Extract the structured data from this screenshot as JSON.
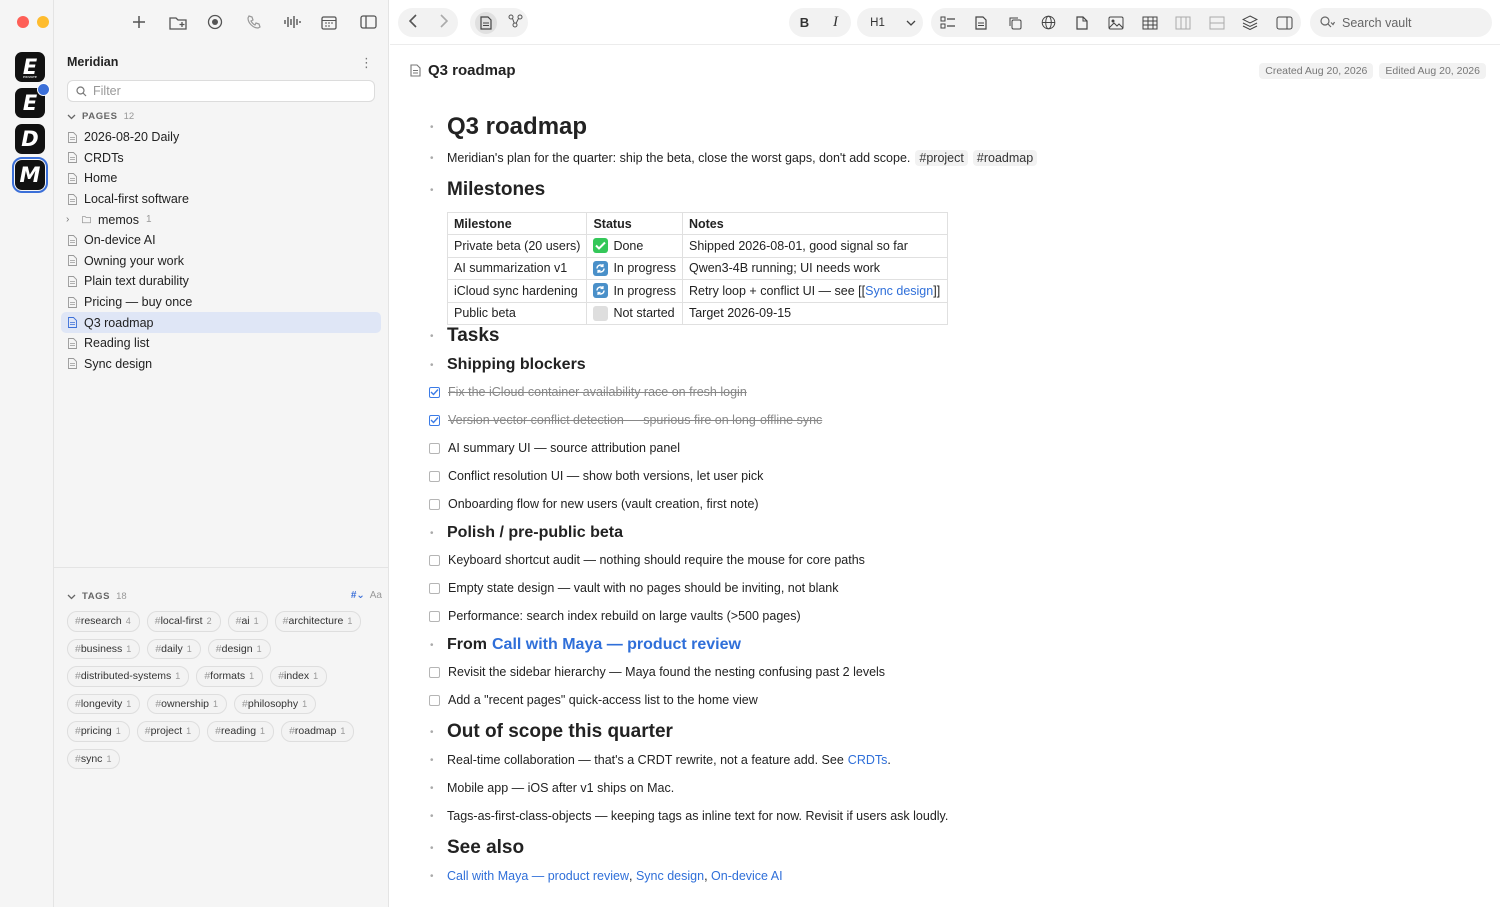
{
  "app": {
    "vault_name": "Meridian"
  },
  "vaults": [
    {
      "letter": "E",
      "sub": "PRIVATE"
    },
    {
      "letter": "E",
      "sub": ""
    },
    {
      "letter": "D",
      "sub": ""
    },
    {
      "letter": "M",
      "sub": ""
    }
  ],
  "sidebar": {
    "filter_placeholder": "Filter",
    "pages_label": "PAGES",
    "pages_count": "12",
    "pages": [
      {
        "label": "2026-08-20 Daily"
      },
      {
        "label": "CRDTs"
      },
      {
        "label": "Home"
      },
      {
        "label": "Local-first software"
      },
      {
        "label": "memos",
        "folder": true,
        "count": "1"
      },
      {
        "label": "On-device AI"
      },
      {
        "label": "Owning your work"
      },
      {
        "label": "Plain text durability"
      },
      {
        "label": "Pricing — buy once"
      },
      {
        "label": "Q3 roadmap",
        "selected": true
      },
      {
        "label": "Reading list"
      },
      {
        "label": "Sync design"
      }
    ],
    "tags_label": "TAGS",
    "tags_count": "18",
    "tag_sort_label": "Aa",
    "tags": [
      {
        "name": "research",
        "count": "4"
      },
      {
        "name": "local-first",
        "count": "2"
      },
      {
        "name": "ai",
        "count": "1"
      },
      {
        "name": "architecture",
        "count": "1"
      },
      {
        "name": "business",
        "count": "1"
      },
      {
        "name": "daily",
        "count": "1"
      },
      {
        "name": "design",
        "count": "1"
      },
      {
        "name": "distributed-systems",
        "count": "1"
      },
      {
        "name": "formats",
        "count": "1"
      },
      {
        "name": "index",
        "count": "1"
      },
      {
        "name": "longevity",
        "count": "1"
      },
      {
        "name": "ownership",
        "count": "1"
      },
      {
        "name": "philosophy",
        "count": "1"
      },
      {
        "name": "pricing",
        "count": "1"
      },
      {
        "name": "project",
        "count": "1"
      },
      {
        "name": "reading",
        "count": "1"
      },
      {
        "name": "roadmap",
        "count": "1"
      },
      {
        "name": "sync",
        "count": "1"
      }
    ]
  },
  "toolbar": {
    "heading_label": "H1",
    "search_label": "Search vault"
  },
  "doc": {
    "title": "Q3 roadmap",
    "created": "Created Aug 20, 2026",
    "edited": "Edited Aug 20, 2026",
    "h1": "Q3 roadmap",
    "intro": "Meridian's plan for the quarter: ship the beta, close the worst gaps, don't add scope.",
    "intro_tags": [
      "#project",
      "#roadmap"
    ],
    "milestones_heading": "Milestones",
    "table_headers": [
      "Milestone",
      "Status",
      "Notes"
    ],
    "milestones": [
      {
        "name": "Private beta (20 users)",
        "status": "Done",
        "status_kind": "done",
        "notes": "Shipped 2026-08-01, good signal so far"
      },
      {
        "name": "AI summarization v1",
        "status": "In progress",
        "status_kind": "prog",
        "notes": "Qwen3-4B running; UI needs work"
      },
      {
        "name": "iCloud sync hardening",
        "status": "In progress",
        "status_kind": "prog",
        "notes_pre": "Retry loop + conflict UI — see [[",
        "notes_link": "Sync design",
        "notes_post": "]]"
      },
      {
        "name": "Public beta",
        "status": "Not started",
        "status_kind": "not",
        "notes": "Target 2026-09-15"
      }
    ],
    "tasks_heading": "Tasks",
    "blockers_heading": "Shipping blockers",
    "blockers": [
      {
        "text": "Fix the iCloud container availability race on fresh login",
        "done": true
      },
      {
        "text": "Version vector conflict detection — spurious fire on long-offline sync",
        "done": true
      },
      {
        "text": "AI summary UI — source attribution panel",
        "done": false
      },
      {
        "text": "Conflict resolution UI — show both versions, let user pick",
        "done": false
      },
      {
        "text": "Onboarding flow for new users (vault creation, first note)",
        "done": false
      }
    ],
    "polish_heading": "Polish / pre-public beta",
    "polish": [
      {
        "text": "Keyboard shortcut audit — nothing should require the mouse for core paths",
        "done": false
      },
      {
        "text": "Empty state design — vault with no pages should be inviting, not blank",
        "done": false
      },
      {
        "text": "Performance: search index rebuild on large vaults (>500 pages)",
        "done": false
      }
    ],
    "from_heading_prefix": "From",
    "from_heading_link": "Call with Maya — product review",
    "from_items": [
      {
        "text": "Revisit the sidebar hierarchy — Maya found the nesting confusing past 2 levels",
        "done": false
      },
      {
        "text": "Add a \"recent pages\" quick-access list to the home view",
        "done": false
      }
    ],
    "oos_heading": "Out of scope this quarter",
    "oos_1_pre": "Real-time collaboration — that's a CRDT rewrite, not a feature add. See",
    "oos_1_link": "CRDTs",
    "oos_1_post": ".",
    "oos_2": "Mobile app — iOS after v1 ships on Mac.",
    "oos_3": "Tags-as-first-class-objects — keeping tags as inline text for now. Revisit if users ask loudly.",
    "see_also_heading": "See also",
    "see_also_links": [
      "Call with Maya — product review",
      "Sync design",
      "On-device AI"
    ]
  }
}
